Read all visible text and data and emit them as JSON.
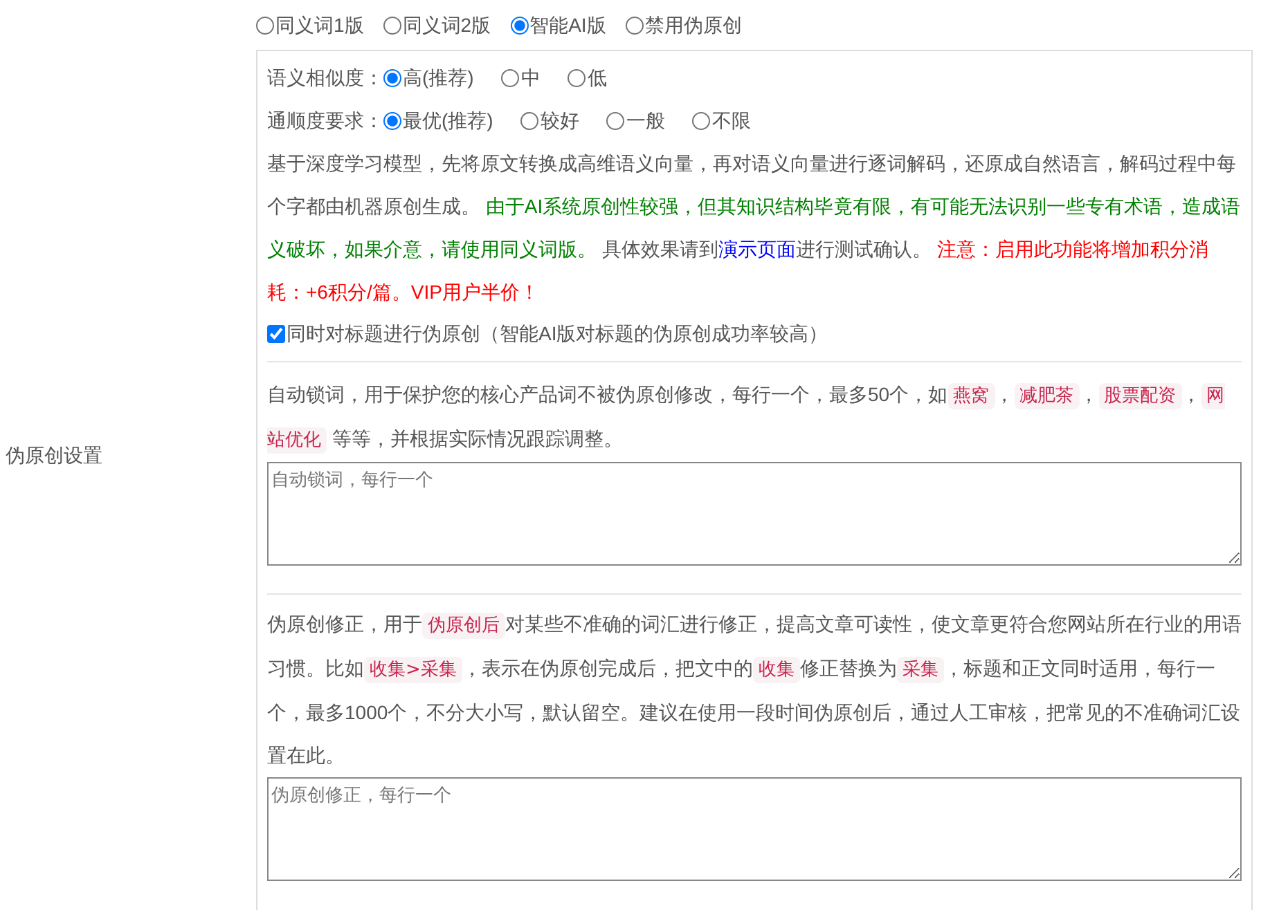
{
  "section_label": "伪原创设置",
  "modes": [
    {
      "label": "同义词1版",
      "selected": false
    },
    {
      "label": "同义词2版",
      "selected": false
    },
    {
      "label": "智能AI版",
      "selected": true
    },
    {
      "label": "禁用伪原创",
      "selected": false
    }
  ],
  "similarity": {
    "label": "语义相似度：",
    "options": [
      {
        "label": "高(推荐)",
        "selected": true
      },
      {
        "label": "中",
        "selected": false
      },
      {
        "label": "低",
        "selected": false
      }
    ]
  },
  "fluency": {
    "label": "通顺度要求：",
    "options": [
      {
        "label": "最优(推荐)",
        "selected": true
      },
      {
        "label": "较好",
        "selected": false
      },
      {
        "label": "一般",
        "selected": false
      },
      {
        "label": "不限",
        "selected": false
      }
    ]
  },
  "description": [
    {
      "kind": "text",
      "text": "基于深度学习模型，先将原文转换成高维语义向量，再对语义向量进行逐词解码，还原成自然语言，解码过程中每个字都由机器原创生成。 "
    },
    {
      "kind": "green",
      "text": "由于AI系统原创性较强，但其知识结构毕竟有限，有可能无法识别一些专有术语，造成语义破坏，如果介意，请使用同义词版。"
    },
    {
      "kind": "text",
      "text": " 具体效果请到"
    },
    {
      "kind": "link",
      "text": "演示页面"
    },
    {
      "kind": "text",
      "text": "进行测试确认。 "
    },
    {
      "kind": "red",
      "text": "注意：启用此功能将增加积分消耗：+6积分/篇。VIP用户半价！"
    }
  ],
  "title_option": {
    "label": "同时对标题进行伪原创（智能AI版对标题的伪原创成功率较高）",
    "checked": true
  },
  "lock_words": {
    "description": [
      {
        "kind": "text",
        "text": "自动锁词，用于保护您的核心产品词不被伪原创修改，每行一个，最多50个，如"
      },
      {
        "kind": "code",
        "text": "燕窝"
      },
      {
        "kind": "text",
        "text": "，"
      },
      {
        "kind": "code",
        "text": "减肥茶"
      },
      {
        "kind": "text",
        "text": "，"
      },
      {
        "kind": "code",
        "text": "股票配资"
      },
      {
        "kind": "text",
        "text": "，"
      },
      {
        "kind": "code",
        "text": "网站优化"
      },
      {
        "kind": "text",
        "text": " 等等，并根据实际情况跟踪调整。"
      }
    ],
    "placeholder": "自动锁词，每行一个"
  },
  "correction": {
    "description": [
      {
        "kind": "text",
        "text": "伪原创修正，用于"
      },
      {
        "kind": "code",
        "text": "伪原创后"
      },
      {
        "kind": "text",
        "text": "对某些不准确的词汇进行修正，提高文章可读性，使文章更符合您网站所在行业的用语习惯。比如"
      },
      {
        "kind": "code",
        "text": "收集>采集"
      },
      {
        "kind": "text",
        "text": "，表示在伪原创完成后，把文中的"
      },
      {
        "kind": "code",
        "text": "收集"
      },
      {
        "kind": "text",
        "text": "修正替换为"
      },
      {
        "kind": "code",
        "text": "采集"
      },
      {
        "kind": "text",
        "text": "，标题和正文同时适用，每行一个，最多1000个，不分大小写，默认留空。建议在使用一段时间伪原创后，通过人工审核，把常见的不准确词汇设置在此。"
      }
    ],
    "placeholder": "伪原创修正，每行一个"
  }
}
